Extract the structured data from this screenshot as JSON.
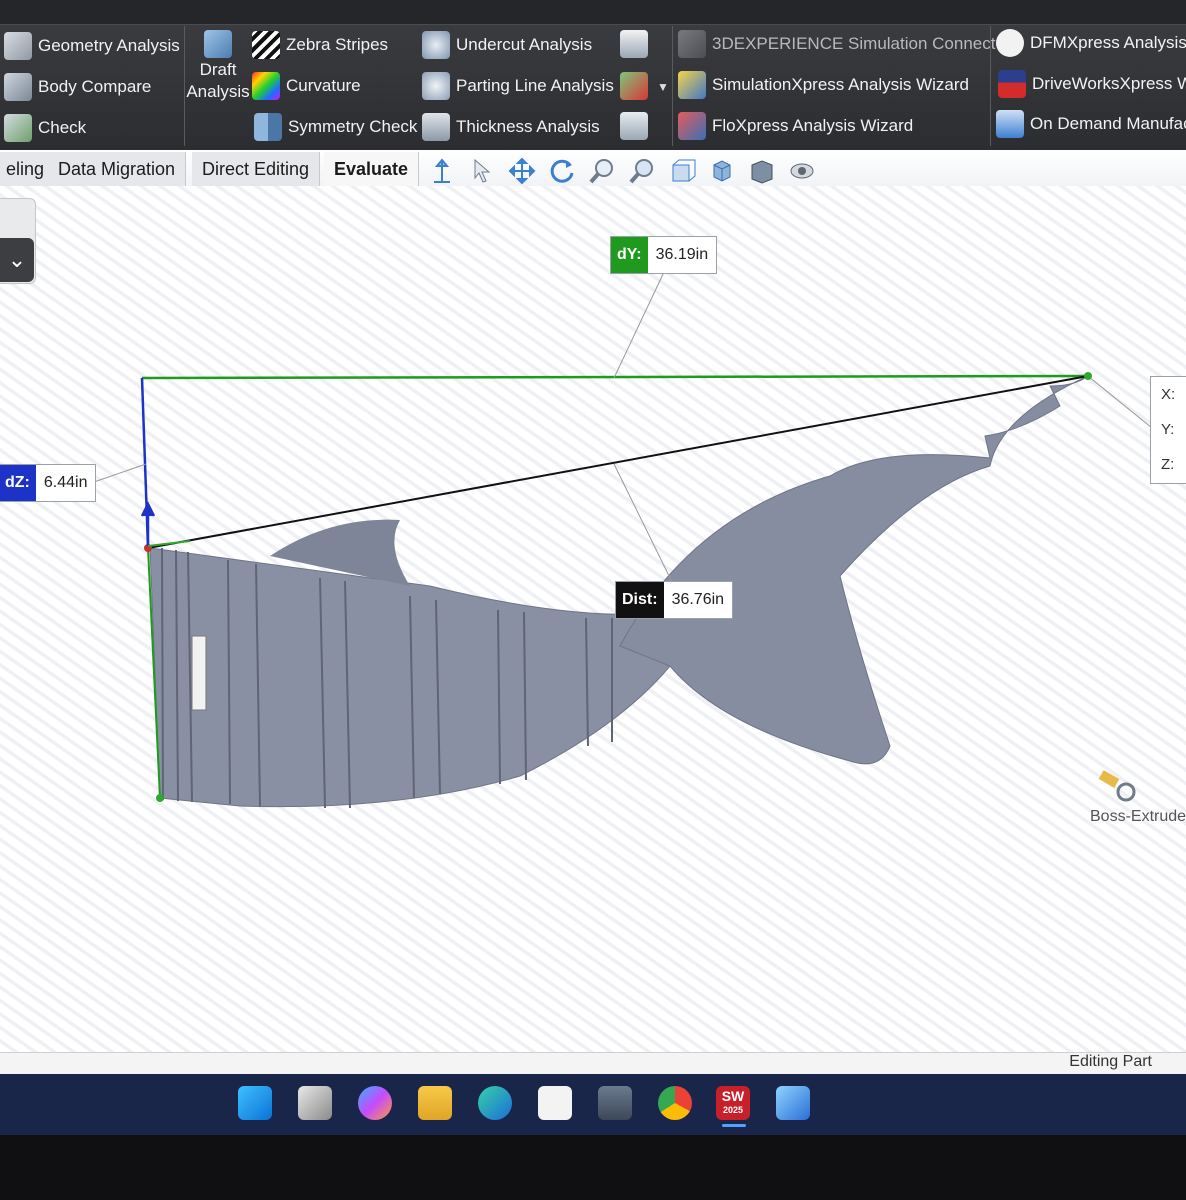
{
  "ribbon": {
    "groups": [
      {
        "items": [
          {
            "label": "Geometry Analysis",
            "icon": "geometry-analysis-icon"
          },
          {
            "label": "Body Compare",
            "icon": "body-compare-icon"
          },
          {
            "label": "Check",
            "icon": "check-icon"
          }
        ]
      },
      {
        "items": [
          {
            "label_line1": "Draft",
            "label_line2": "Analysis",
            "icon": "draft-analysis-icon"
          }
        ]
      },
      {
        "items": [
          {
            "label": "Zebra Stripes",
            "icon": "zebra-stripes-icon"
          },
          {
            "label": "Curvature",
            "icon": "curvature-icon"
          },
          {
            "label": "Symmetry Check",
            "icon": "symmetry-check-icon"
          }
        ]
      },
      {
        "items": [
          {
            "label": "Undercut Analysis",
            "icon": "undercut-analysis-icon"
          },
          {
            "label": "Parting Line Analysis",
            "icon": "parting-line-analysis-icon"
          },
          {
            "label": "Thickness Analysis",
            "icon": "thickness-analysis-icon"
          }
        ]
      },
      {
        "items": [
          {
            "label": "3DEXPERIENCE Simulation Connector",
            "icon": "simulation-connector-icon"
          },
          {
            "label": "SimulationXpress Analysis Wizard",
            "icon": "simulationxpress-icon"
          },
          {
            "label": "FloXpress Analysis Wizard",
            "icon": "floxpress-icon"
          }
        ]
      },
      {
        "items": [
          {
            "label": "DFMXpress Analysis W",
            "icon": "dfmxpress-icon"
          },
          {
            "label": "DriveWorksXpress Wi",
            "icon": "driveworks-icon"
          },
          {
            "label": "On Demand Manufac",
            "icon": "on-demand-manufacturing-icon"
          }
        ]
      }
    ]
  },
  "tabs": [
    {
      "label": "eling"
    },
    {
      "label": "Data Migration"
    },
    {
      "label": "Direct Editing"
    },
    {
      "label": "Evaluate",
      "active": true
    }
  ],
  "viewport": {
    "dy_label": "dY:",
    "dy_value": "36.19in",
    "dz_label": "dZ:",
    "dz_value": "6.44in",
    "dist_label": "Dist:",
    "dist_value": "36.76in",
    "xyz_labels": [
      "X:",
      "Y:",
      "Z:"
    ],
    "feature_label": "Boss-Extrude"
  },
  "status": {
    "text": "Editing Part"
  },
  "taskbar": {
    "apps": [
      "start-icon",
      "task-view-icon",
      "copilot-icon",
      "file-explorer-icon",
      "edge-icon",
      "store-icon",
      "calculator-icon",
      "chrome-icon",
      "solidworks-icon",
      "photos-icon"
    ],
    "solidworks_badge": "SW",
    "solidworks_year": "2025"
  },
  "colors": {
    "dy_green": "#1f9a1f",
    "dz_blue": "#1d33c7",
    "dist_black": "#111111",
    "model_gray": "#8a90a3"
  }
}
